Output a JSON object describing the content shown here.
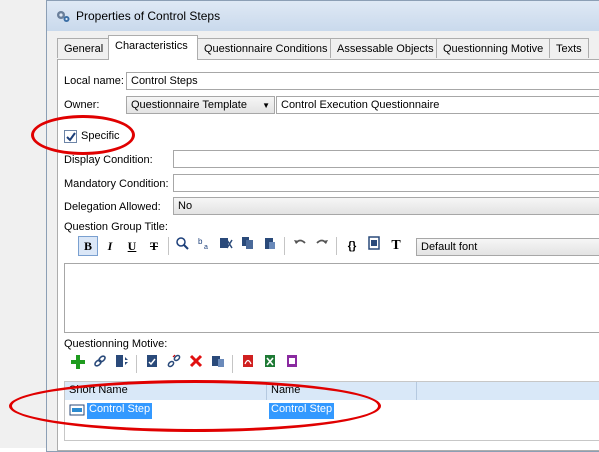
{
  "window": {
    "title": "Properties of Control Steps"
  },
  "tabs": [
    "General",
    "Characteristics",
    "Questionnaire Conditions",
    "Assessable Objects",
    "Questionning Motive",
    "Texts"
  ],
  "form": {
    "local_name_label": "Local name:",
    "local_name_value": "Control Steps",
    "owner_label": "Owner:",
    "owner_type": "Questionnaire Template",
    "owner_value": "Control Execution Questionnaire",
    "specific_label": "Specific",
    "specific_checked": true,
    "display_condition_label": "Display Condition:",
    "mandatory_condition_label": "Mandatory Condition:",
    "delegation_label": "Delegation Allowed:",
    "delegation_value": "No",
    "question_group_title_label": "Question Group Title:",
    "font_select": "Default font",
    "questionning_motive_label": "Questionning Motive:"
  },
  "editor_toolbar": {
    "bold": "B",
    "italic": "I",
    "underline": "U",
    "strike": "T",
    "braces": "{}",
    "text_tool": "T"
  },
  "grid": {
    "columns": [
      "Short Name",
      "Name"
    ],
    "rows": [
      {
        "short_name": "Control Step",
        "name": "Control Step"
      }
    ]
  },
  "colors": {
    "annotation": "#e00000",
    "selection": "#3399ff",
    "header": "#d9e8f8"
  }
}
